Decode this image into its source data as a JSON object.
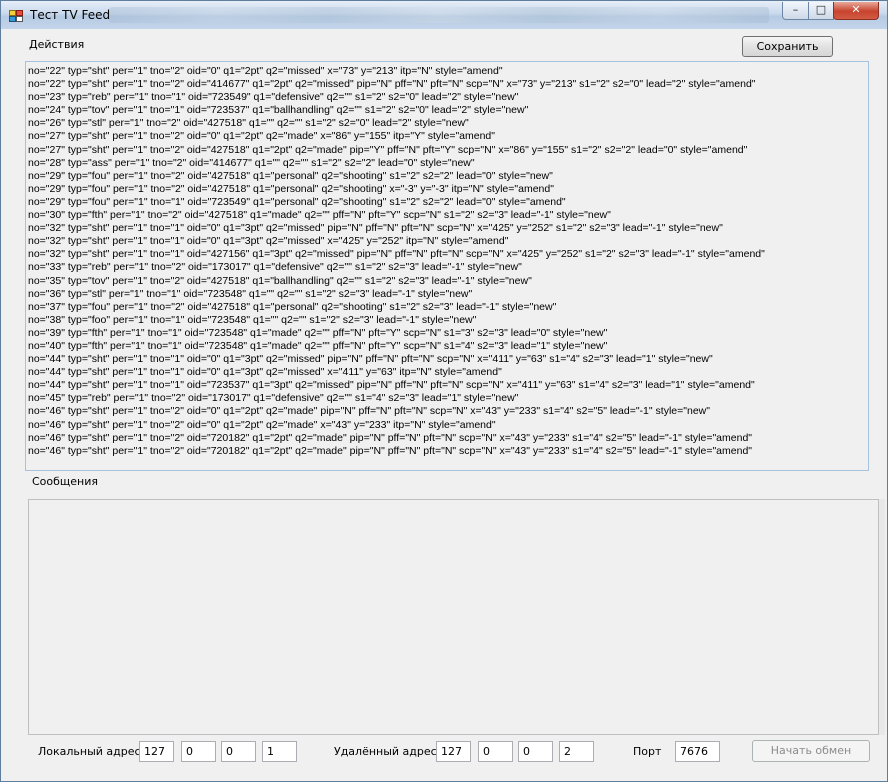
{
  "window": {
    "title": "Тест TV Feed",
    "buttons": {
      "minimize": "–",
      "maximize": "□",
      "close": "✕"
    }
  },
  "actions": {
    "label": "Действия",
    "save_button": "Сохранить",
    "lines": [
      "no=\"22\" typ=\"sht\" per=\"1\" tno=\"2\" oid=\"0\" q1=\"2pt\" q2=\"missed\" x=\"73\" y=\"213\" itp=\"N\" style=\"amend\"",
      "no=\"22\" typ=\"sht\" per=\"1\" tno=\"2\" oid=\"414677\" q1=\"2pt\" q2=\"missed\" pip=\"N\" pff=\"N\" pft=\"N\" scp=\"N\" x=\"73\" y=\"213\" s1=\"2\" s2=\"0\" lead=\"2\" style=\"amend\"",
      "no=\"23\" typ=\"reb\" per=\"1\" tno=\"1\" oid=\"723549\" q1=\"defensive\" q2=\"\" s1=\"2\" s2=\"0\" lead=\"2\" style=\"new\"",
      "no=\"24\" typ=\"tov\" per=\"1\" tno=\"1\" oid=\"723537\" q1=\"ballhandling\" q2=\"\" s1=\"2\" s2=\"0\" lead=\"2\" style=\"new\"",
      "no=\"26\" typ=\"stl\" per=\"1\" tno=\"2\" oid=\"427518\" q1=\"\" q2=\"\" s1=\"2\" s2=\"0\" lead=\"2\" style=\"new\"",
      "no=\"27\" typ=\"sht\" per=\"1\" tno=\"2\" oid=\"0\" q1=\"2pt\" q2=\"made\" x=\"86\" y=\"155\" itp=\"Y\" style=\"amend\"",
      "no=\"27\" typ=\"sht\" per=\"1\" tno=\"2\" oid=\"427518\" q1=\"2pt\" q2=\"made\" pip=\"Y\" pff=\"N\" pft=\"Y\" scp=\"N\" x=\"86\" y=\"155\" s1=\"2\" s2=\"2\" lead=\"0\" style=\"amend\"",
      "no=\"28\" typ=\"ass\" per=\"1\" tno=\"2\" oid=\"414677\" q1=\"\" q2=\"\" s1=\"2\" s2=\"2\" lead=\"0\" style=\"new\"",
      "no=\"29\" typ=\"fou\" per=\"1\" tno=\"2\" oid=\"427518\" q1=\"personal\" q2=\"shooting\" s1=\"2\" s2=\"2\" lead=\"0\" style=\"new\"",
      "no=\"29\" typ=\"fou\" per=\"1\" tno=\"2\" oid=\"427518\" q1=\"personal\" q2=\"shooting\" x=\"-3\" y=\"-3\" itp=\"N\" style=\"amend\"",
      "no=\"29\" typ=\"fou\" per=\"1\" tno=\"1\" oid=\"723549\" q1=\"personal\" q2=\"shooting\" s1=\"2\" s2=\"2\" lead=\"0\" style=\"amend\"",
      "no=\"30\" typ=\"fth\" per=\"1\" tno=\"2\" oid=\"427518\" q1=\"made\" q2=\"\" pff=\"N\" pft=\"Y\" scp=\"N\" s1=\"2\" s2=\"3\" lead=\"-1\" style=\"new\"",
      "no=\"32\" typ=\"sht\" per=\"1\" tno=\"1\" oid=\"0\" q1=\"3pt\" q2=\"missed\" pip=\"N\" pff=\"N\" pft=\"N\" scp=\"N\" x=\"425\" y=\"252\" s1=\"2\" s2=\"3\" lead=\"-1\" style=\"new\"",
      "no=\"32\" typ=\"sht\" per=\"1\" tno=\"1\" oid=\"0\" q1=\"3pt\" q2=\"missed\" x=\"425\" y=\"252\" itp=\"N\" style=\"amend\"",
      "no=\"32\" typ=\"sht\" per=\"1\" tno=\"1\" oid=\"427156\" q1=\"3pt\" q2=\"missed\" pip=\"N\" pff=\"N\" pft=\"N\" scp=\"N\" x=\"425\" y=\"252\" s1=\"2\" s2=\"3\" lead=\"-1\" style=\"amend\"",
      "no=\"33\" typ=\"reb\" per=\"1\" tno=\"2\" oid=\"173017\" q1=\"defensive\" q2=\"\" s1=\"2\" s2=\"3\" lead=\"-1\" style=\"new\"",
      "no=\"35\" typ=\"tov\" per=\"1\" tno=\"2\" oid=\"427518\" q1=\"ballhandling\" q2=\"\" s1=\"2\" s2=\"3\" lead=\"-1\" style=\"new\"",
      "no=\"36\" typ=\"stl\" per=\"1\" tno=\"1\" oid=\"723548\" q1=\"\" q2=\"\" s1=\"2\" s2=\"3\" lead=\"-1\" style=\"new\"",
      "no=\"37\" typ=\"fou\" per=\"1\" tno=\"2\" oid=\"427518\" q1=\"personal\" q2=\"shooting\" s1=\"2\" s2=\"3\" lead=\"-1\" style=\"new\"",
      "no=\"38\" typ=\"foo\" per=\"1\" tno=\"1\" oid=\"723548\" q1=\"\" q2=\"\" s1=\"2\" s2=\"3\" lead=\"-1\" style=\"new\"",
      "no=\"39\" typ=\"fth\" per=\"1\" tno=\"1\" oid=\"723548\" q1=\"made\" q2=\"\" pff=\"N\" pft=\"Y\" scp=\"N\" s1=\"3\" s2=\"3\" lead=\"0\" style=\"new\"",
      "no=\"40\" typ=\"fth\" per=\"1\" tno=\"1\" oid=\"723548\" q1=\"made\" q2=\"\" pff=\"N\" pft=\"Y\" scp=\"N\" s1=\"4\" s2=\"3\" lead=\"1\" style=\"new\"",
      "no=\"44\" typ=\"sht\" per=\"1\" tno=\"1\" oid=\"0\" q1=\"3pt\" q2=\"missed\" pip=\"N\" pff=\"N\" pft=\"N\" scp=\"N\" x=\"411\" y=\"63\" s1=\"4\" s2=\"3\" lead=\"1\" style=\"new\"",
      "no=\"44\" typ=\"sht\" per=\"1\" tno=\"1\" oid=\"0\" q1=\"3pt\" q2=\"missed\" x=\"411\" y=\"63\" itp=\"N\" style=\"amend\"",
      "no=\"44\" typ=\"sht\" per=\"1\" tno=\"1\" oid=\"723537\" q1=\"3pt\" q2=\"missed\" pip=\"N\" pff=\"N\" pft=\"N\" scp=\"N\" x=\"411\" y=\"63\" s1=\"4\" s2=\"3\" lead=\"1\" style=\"amend\"",
      "no=\"45\" typ=\"reb\" per=\"1\" tno=\"2\" oid=\"173017\" q1=\"defensive\" q2=\"\" s1=\"4\" s2=\"3\" lead=\"1\" style=\"new\"",
      "no=\"46\" typ=\"sht\" per=\"1\" tno=\"2\" oid=\"0\" q1=\"2pt\" q2=\"made\" pip=\"N\" pff=\"N\" pft=\"N\" scp=\"N\" x=\"43\" y=\"233\" s1=\"4\" s2=\"5\" lead=\"-1\" style=\"new\"",
      "no=\"46\" typ=\"sht\" per=\"1\" tno=\"2\" oid=\"0\" q1=\"2pt\" q2=\"made\" x=\"43\" y=\"233\" itp=\"N\" style=\"amend\"",
      "no=\"46\" typ=\"sht\" per=\"1\" tno=\"2\" oid=\"720182\" q1=\"2pt\" q2=\"made\" pip=\"N\" pff=\"N\" pft=\"N\" scp=\"N\" x=\"43\" y=\"233\" s1=\"4\" s2=\"5\" lead=\"-1\" style=\"amend\"",
      "no=\"46\" typ=\"sht\" per=\"1\" tno=\"2\" oid=\"720182\" q1=\"2pt\" q2=\"made\" pip=\"N\" pff=\"N\" pft=\"N\" scp=\"N\" x=\"43\" y=\"233\" s1=\"4\" s2=\"5\" lead=\"-1\" style=\"amend\""
    ]
  },
  "messages": {
    "label": "Сообщения"
  },
  "connection": {
    "local_label": "Локальный адрес",
    "local_ip": [
      "127",
      "0",
      "0",
      "1"
    ],
    "remote_label": "Удалённый  адрес",
    "remote_ip": [
      "127",
      "0",
      "0",
      "2"
    ],
    "port_label": "Порт",
    "port": "7676",
    "start_button": "Начать обмен"
  }
}
